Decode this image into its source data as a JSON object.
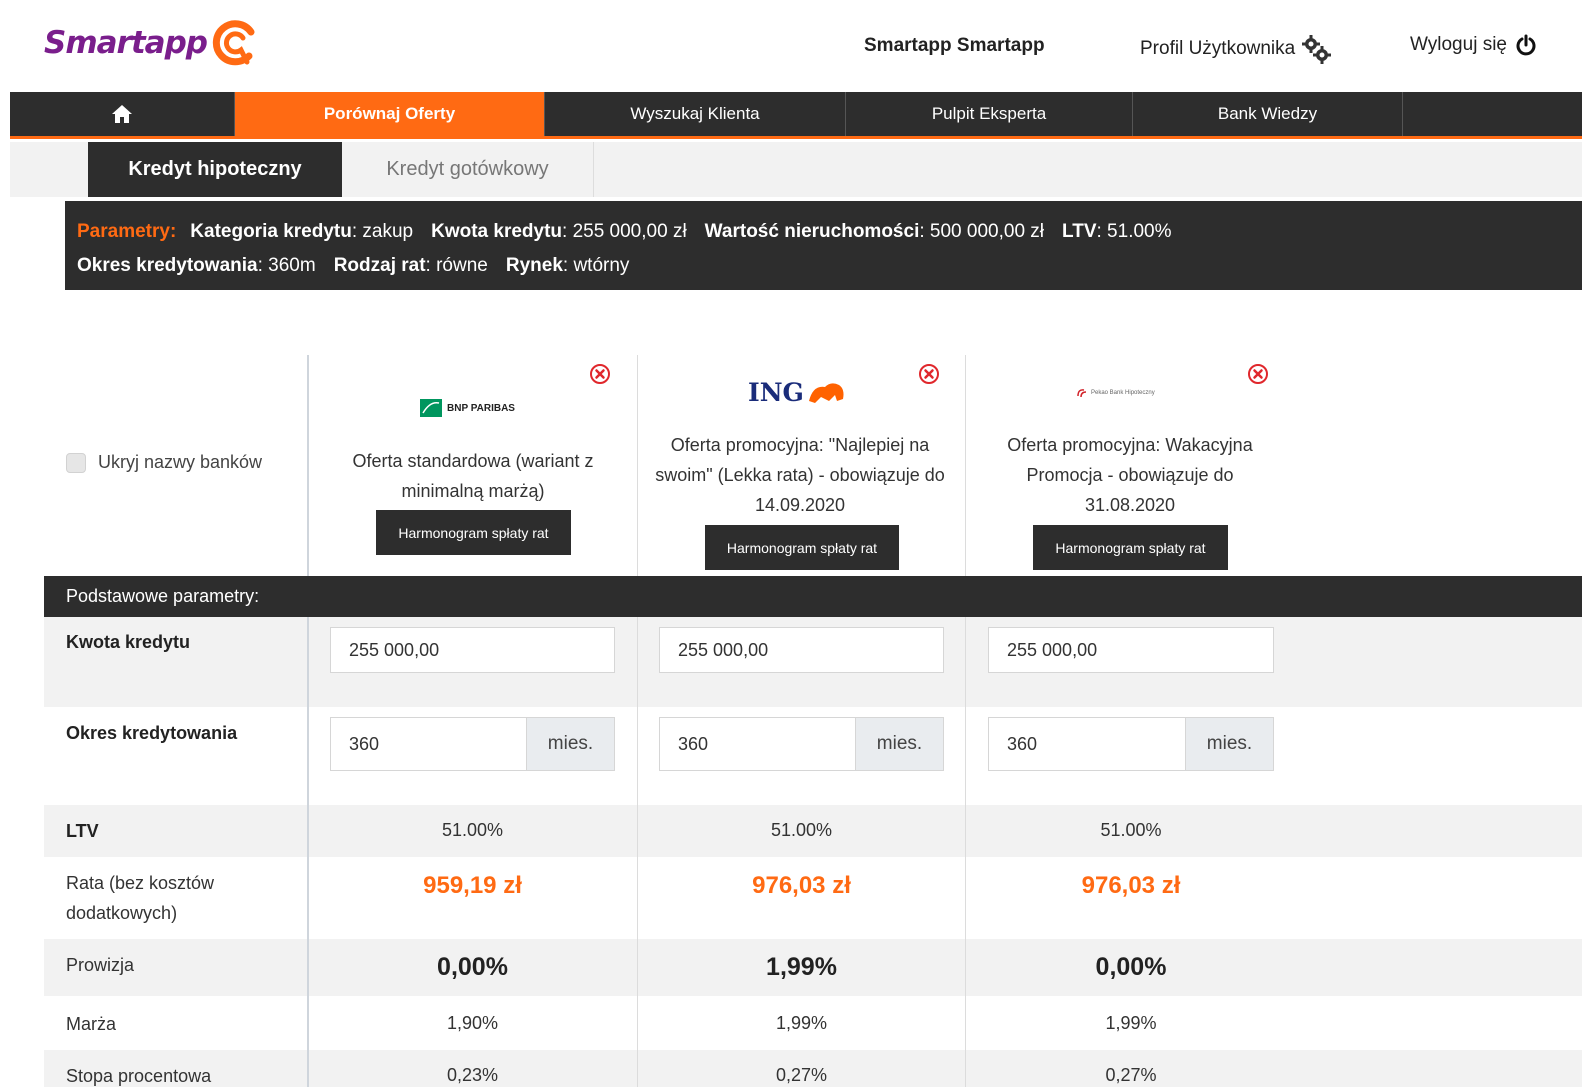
{
  "header": {
    "logo_text": "Smartapp",
    "user_name": "Smartapp Smartapp",
    "profile_label": "Profil Użytkownika",
    "logout_label": "Wyloguj się"
  },
  "main_nav": {
    "home_icon": "home-icon",
    "items": [
      {
        "label": "Porównaj Oferty",
        "active": true
      },
      {
        "label": "Wyszukaj Klienta",
        "active": false
      },
      {
        "label": "Pulpit Eksperta",
        "active": false
      },
      {
        "label": "Bank Wiedzy",
        "active": false
      }
    ]
  },
  "sub_tabs": [
    {
      "label": "Kredyt hipoteczny",
      "active": true
    },
    {
      "label": "Kredyt gotówkowy",
      "active": false
    }
  ],
  "params": {
    "title": "Parametry:",
    "kategoria_label": "Kategoria kredytu",
    "kategoria_value": ": zakup",
    "kwota_label": "Kwota kredytu",
    "kwota_value": ": 255 000,00 zł",
    "wartosc_label": "Wartość nieruchomości",
    "wartosc_value": ": 500 000,00 zł",
    "ltv_label": "LTV",
    "ltv_value": ": 51.00%",
    "okres_label": "Okres kredytowania",
    "okres_value": ": 360m",
    "rodzaj_label": "Rodzaj rat",
    "rodzaj_value": ": równe",
    "rynek_label": "Rynek",
    "rynek_value": ": wtórny"
  },
  "hide_names_label": "Ukryj nazwy banków",
  "section_header": "Podstawowe parametry:",
  "row_labels": {
    "kwota": "Kwota kredytu",
    "okres": "Okres kredytowania",
    "ltv": "LTV",
    "rata": "Rata (bez kosztów dodatkowych)",
    "prowizja": "Prowizja",
    "marza": "Marża",
    "stopa": "Stopa procentowa"
  },
  "harmonogram_label": "Harmonogram spłaty rat",
  "unit_label": "mies.",
  "banks": [
    {
      "logo_text": "BNP PARIBAS",
      "offer": "Oferta standardowa (wariant z minimalną marżą)",
      "kwota": "255 000,00",
      "okres": "360",
      "ltv": "51.00%",
      "rata": "959,19 zł",
      "prowizja": "0,00%",
      "marza": "1,90%",
      "stopa": "0,23%"
    },
    {
      "logo_text": "ING",
      "offer": "Oferta promocyjna: \"Najlepiej na swoim\" (Lekka rata) - obowiązuje do 14.09.2020",
      "kwota": "255 000,00",
      "okres": "360",
      "ltv": "51.00%",
      "rata": "976,03 zł",
      "prowizja": "1,99%",
      "marza": "1,99%",
      "stopa": "0,27%"
    },
    {
      "logo_text": "Pekao Bank Hipoteczny",
      "offer": "Oferta promocyjna: Wakacyjna Promocja - obowiązuje do 31.08.2020",
      "kwota": "255 000,00",
      "okres": "360",
      "ltv": "51.00%",
      "rata": "976,03 zł",
      "prowizja": "0,00%",
      "marza": "1,99%",
      "stopa": "0,27%"
    }
  ]
}
